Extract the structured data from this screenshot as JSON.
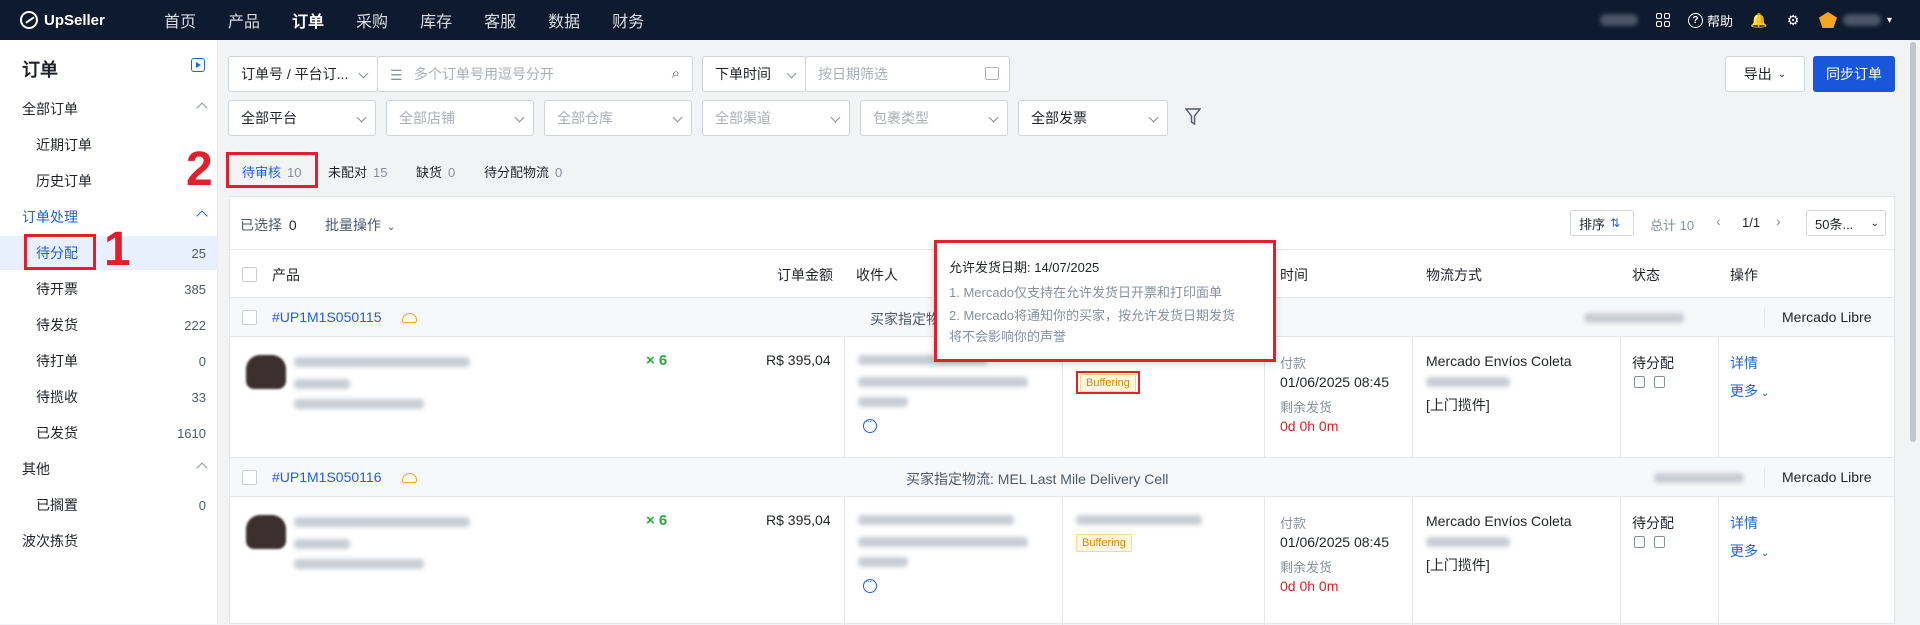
{
  "topnav": {
    "logo": "UpSeller",
    "items": [
      "首页",
      "产品",
      "订单",
      "采购",
      "库存",
      "客服",
      "数据",
      "财务"
    ],
    "help": "帮助"
  },
  "sidebar": {
    "title": "订单",
    "group1": "全部订单",
    "recent": "近期订单",
    "history": "历史订单",
    "group2": "订单处理",
    "items": [
      {
        "label": "待分配",
        "count": "25"
      },
      {
        "label": "待开票",
        "count": "385"
      },
      {
        "label": "待发货",
        "count": "222"
      },
      {
        "label": "待打单",
        "count": "0"
      },
      {
        "label": "待揽收",
        "count": "33"
      },
      {
        "label": "已发货",
        "count": "1610"
      }
    ],
    "group3": "其他",
    "shelved": {
      "label": "已搁置",
      "count": "0"
    },
    "wave": "波次拣货"
  },
  "annotations": {
    "one": "1",
    "two": "2"
  },
  "filters": {
    "search_type": "订单号 / 平台订...",
    "search_placeholder": "多个订单号用逗号分开",
    "time_type": "下单时间",
    "date_placeholder": "按日期筛选",
    "platform": "全部平台",
    "shop": "全部店铺",
    "warehouse": "全部仓库",
    "channel": "全部渠道",
    "package": "包裹类型",
    "invoice": "全部发票",
    "export": "导出",
    "sync": "同步订单"
  },
  "tabs": [
    {
      "label": "待审核",
      "count": "10"
    },
    {
      "label": "未配对",
      "count": "15"
    },
    {
      "label": "缺货",
      "count": "0"
    },
    {
      "label": "待分配物流",
      "count": "0"
    }
  ],
  "toolbar": {
    "selected": "已选择",
    "selected_count": "0",
    "bulk": "批量操作",
    "sort": "排序",
    "total": "总计 10",
    "page": "1/1",
    "page_size": "50条..."
  },
  "columns": {
    "product": "产品",
    "amount": "订单金额",
    "receiver": "收件人",
    "time": "时间",
    "logistics": "物流方式",
    "status": "状态",
    "action": "操作"
  },
  "orders": [
    {
      "id": "#UP1M1S050115",
      "buyer_logistics": "买家指定物",
      "platform": "Mercado Libre",
      "qty": "× 6",
      "amount": "R$ 395,04",
      "badge": "Buffering",
      "pay_label": "付款",
      "pay_time": "01/06/2025 08:45",
      "remain_label": "剩余发货",
      "remain": "0d 0h 0m",
      "logistics": "Mercado Envíos Coleta",
      "pickup": "[上门揽件]",
      "status": "待分配",
      "detail": "详情",
      "more": "更多"
    },
    {
      "id": "#UP1M1S050116",
      "buyer_logistics": "买家指定物流: MEL Last Mile Delivery Cell",
      "platform": "Mercado Libre",
      "qty": "× 6",
      "amount": "R$ 395,04",
      "badge": "Buffering",
      "pay_label": "付款",
      "pay_time": "01/06/2025 08:45",
      "remain_label": "剩余发货",
      "remain": "0d 0h 0m",
      "logistics": "Mercado Envíos Coleta",
      "pickup": "[上门揽件]",
      "status": "待分配",
      "detail": "详情",
      "more": "更多"
    }
  ],
  "tooltip": {
    "head": "允许发货日期:  14/07/2025",
    "line1": "1. Mercado仅支持在允许发货日开票和打印面单",
    "line2": "2. Mercado将通知你的买家，按允许发货日期发货",
    "line3": "将不会影响你的声誉"
  }
}
